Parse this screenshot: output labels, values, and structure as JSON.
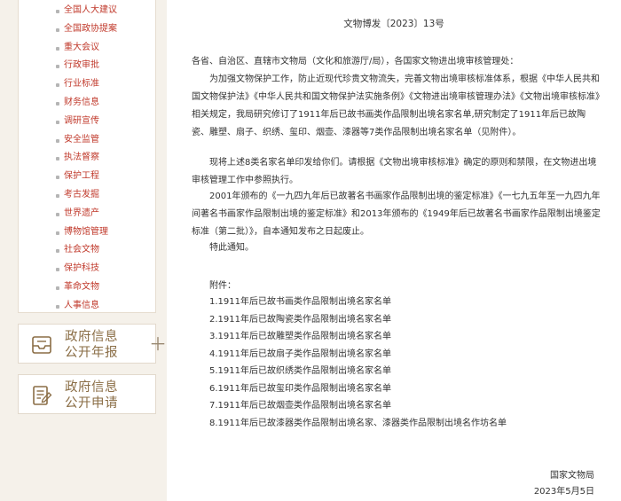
{
  "sidebar": {
    "items": [
      {
        "label": "全国人大建议"
      },
      {
        "label": "全国政协提案"
      },
      {
        "label": "重大会议"
      },
      {
        "label": "行政审批"
      },
      {
        "label": "行业标准"
      },
      {
        "label": "财务信息"
      },
      {
        "label": "调研宣传"
      },
      {
        "label": "安全监管"
      },
      {
        "label": "执法督察"
      },
      {
        "label": "保护工程"
      },
      {
        "label": "考古发掘"
      },
      {
        "label": "世界遗产"
      },
      {
        "label": "博物馆管理"
      },
      {
        "label": "社会文物"
      },
      {
        "label": "保护科技"
      },
      {
        "label": "革命文物"
      },
      {
        "label": "人事信息"
      }
    ],
    "cards": [
      {
        "line1": "政府信息",
        "line2": "公开年报",
        "icon": "report-inbox-icon"
      },
      {
        "line1": "政府信息",
        "line2": "公开申请",
        "icon": "application-form-icon"
      }
    ],
    "plus_icon": "＋"
  },
  "document": {
    "doc_number": "文物博发〔2023〕13号",
    "addressee": "各省、自治区、直辖市文物局（文化和旅游厅/局），各国家文物进出境审核管理处：",
    "paragraphs": [
      "为加强文物保护工作，防止近现代珍贵文物流失，完善文物出境审核标准体系，根据《中华人民共和国文物保护法》《中华人民共和国文物保护法实施条例》《文物进出境审核管理办法》《文物出境审核标准》相关规定，我局研究修订了1911年后已故书画类作品限制出境名家名单,研究制定了1911年后已故陶瓷、雕塑、扇子、织绣、玺印、烟壶、漆器等7类作品限制出境名家名单（见附件）。",
      "现将上述8类名家名单印发给你们。请根据《文物出境审核标准》确定的原则和禁限，在文物进出境审核管理工作中参照执行。",
      "2001年颁布的《一九四九年后已故著名书画家作品限制出境的鉴定标准》《一七九五年至一九四九年间著名书画家作品限制出境的鉴定标准》和2013年颁布的《1949年后已故著名书画家作品限制出境鉴定标准（第二批）》，自本通知发布之日起废止。",
      "特此通知。"
    ],
    "attachments_label": "附件：",
    "attachments": [
      "1.1911年后已故书画类作品限制出境名家名单",
      "2.1911年后已故陶瓷类作品限制出境名家名单",
      "3.1911年后已故雕塑类作品限制出境名家名单",
      "4.1911年后已故扇子类作品限制出境名家名单",
      "5.1911年后已故织绣类作品限制出境名家名单",
      "6.1911年后已故玺印类作品限制出境名家名单",
      "7.1911年后已故烟壶类作品限制出境名家名单",
      "8.1911年后已故漆器类作品限制出境名家、漆器类作品限制出境名作坊名单"
    ],
    "signature_org": "国家文物局",
    "signature_date": "2023年5月5日"
  },
  "colors": {
    "page_bg": "#f5f1ea",
    "nav_link": "#c0392b",
    "card_text": "#8a6d45"
  }
}
